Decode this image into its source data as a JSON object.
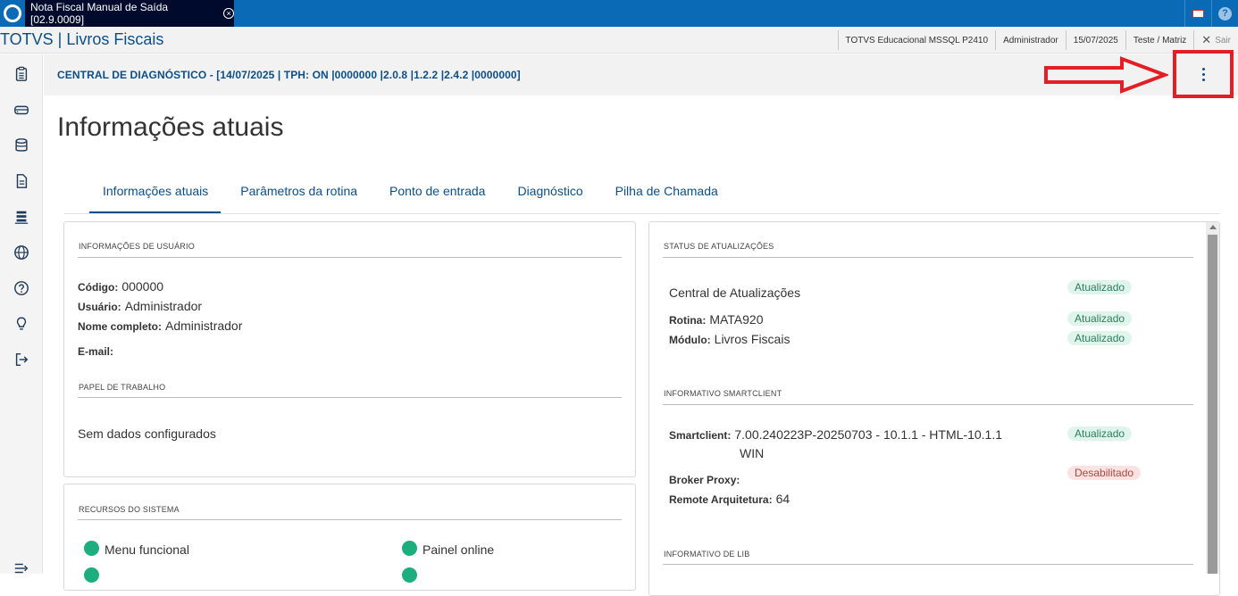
{
  "window": {
    "tab_title": "Nota Fiscal Manual de Saída [02.9.0009]"
  },
  "header": {
    "app_title": "TOTVS | Livros Fiscais",
    "environment": "TOTVS Educacional MSSQL P2410",
    "user": "Administrador",
    "date": "15/07/2025",
    "branch": "Teste / Matriz",
    "exit_label": "Sair"
  },
  "sidebar": {
    "items": [
      "clipboard-icon",
      "drive-icon",
      "database-icon",
      "document-icon",
      "stack-icon",
      "globe-icon",
      "help-icon",
      "lightbulb-icon",
      "logout-icon",
      "expand-icon"
    ]
  },
  "diagnostic": {
    "bar_text": "CENTRAL DE DIAGNÓSTICO - [14/07/2025 | TPH: ON |0000000 |2.0.8 |1.2.2 |2.4.2 |0000000]"
  },
  "page": {
    "title": "Informações atuais"
  },
  "tabs": [
    "Informações atuais",
    "Parâmetros da rotina",
    "Ponto de entrada",
    "Diagnóstico",
    "Pilha de Chamada"
  ],
  "user_info": {
    "section": "INFORMAÇÕES DE USUÁRIO",
    "codigo_label": "Código:",
    "codigo": "000000",
    "usuario_label": "Usuário:",
    "usuario": "Administrador",
    "nome_label": "Nome completo:",
    "nome": "Administrador",
    "email_label": "E-mail:"
  },
  "papel": {
    "section": "PAPEL DE TRABALHO",
    "empty": "Sem dados configurados"
  },
  "recursos": {
    "section": "RECURSOS DO SISTEMA",
    "items": [
      "Menu funcional",
      "Painel online"
    ]
  },
  "status": {
    "section": "STATUS DE ATUALIZAÇÕES",
    "central": "Central de Atualizações",
    "central_status": "Atualizado",
    "rotina_label": "Rotina:",
    "rotina": "MATA920",
    "rotina_status": "Atualizado",
    "modulo_label": "Módulo:",
    "modulo": "Livros Fiscais",
    "modulo_status": "Atualizado"
  },
  "smartclient": {
    "section": "INFORMATIVO SMARTCLIENT",
    "sc_label": "Smartclient:",
    "sc_value_1": "7.00.240223P-20250703 - 10.1.1 - HTML-10.1.1",
    "sc_value_2": "WIN",
    "sc_status": "Atualizado",
    "broker_label": "Broker Proxy:",
    "broker_status": "Desabilitado",
    "arq_label": "Remote Arquitetura:",
    "arq": "64"
  },
  "lib": {
    "section": "INFORMATIVO DE LIB"
  },
  "colors": {
    "brand": "#0a6ab6",
    "accent": "#0b4f8a",
    "ok": "#1cae7d",
    "highlight": "#e31e24"
  }
}
